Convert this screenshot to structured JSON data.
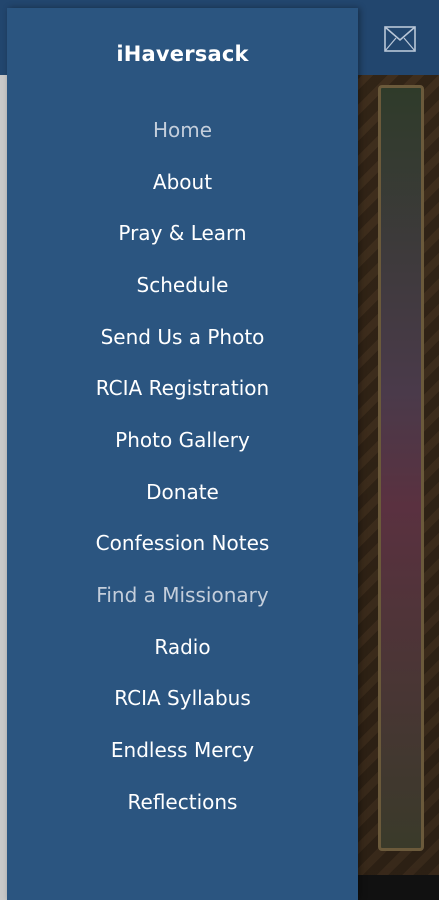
{
  "drawer": {
    "title": "iHaversack",
    "items": [
      {
        "label": "Home",
        "dim": true
      },
      {
        "label": "About",
        "dim": false
      },
      {
        "label": "Pray & Learn",
        "dim": false
      },
      {
        "label": "Schedule",
        "dim": false
      },
      {
        "label": "Send Us a Photo",
        "dim": false
      },
      {
        "label": "RCIA Registration",
        "dim": false
      },
      {
        "label": "Photo Gallery",
        "dim": false
      },
      {
        "label": "Donate",
        "dim": false
      },
      {
        "label": "Confession Notes",
        "dim": false
      },
      {
        "label": "Find a Missionary",
        "dim": true
      },
      {
        "label": "Radio",
        "dim": false
      },
      {
        "label": "RCIA Syllabus",
        "dim": false
      },
      {
        "label": "Endless Mercy",
        "dim": false
      },
      {
        "label": "Reflections",
        "dim": false
      }
    ]
  },
  "header": {
    "icon": "mail-icon"
  },
  "colors": {
    "drawer_bg": "#2b5580",
    "header_bg": "#22466e",
    "text": "#ffffff",
    "text_dim": "#c4cedb"
  }
}
